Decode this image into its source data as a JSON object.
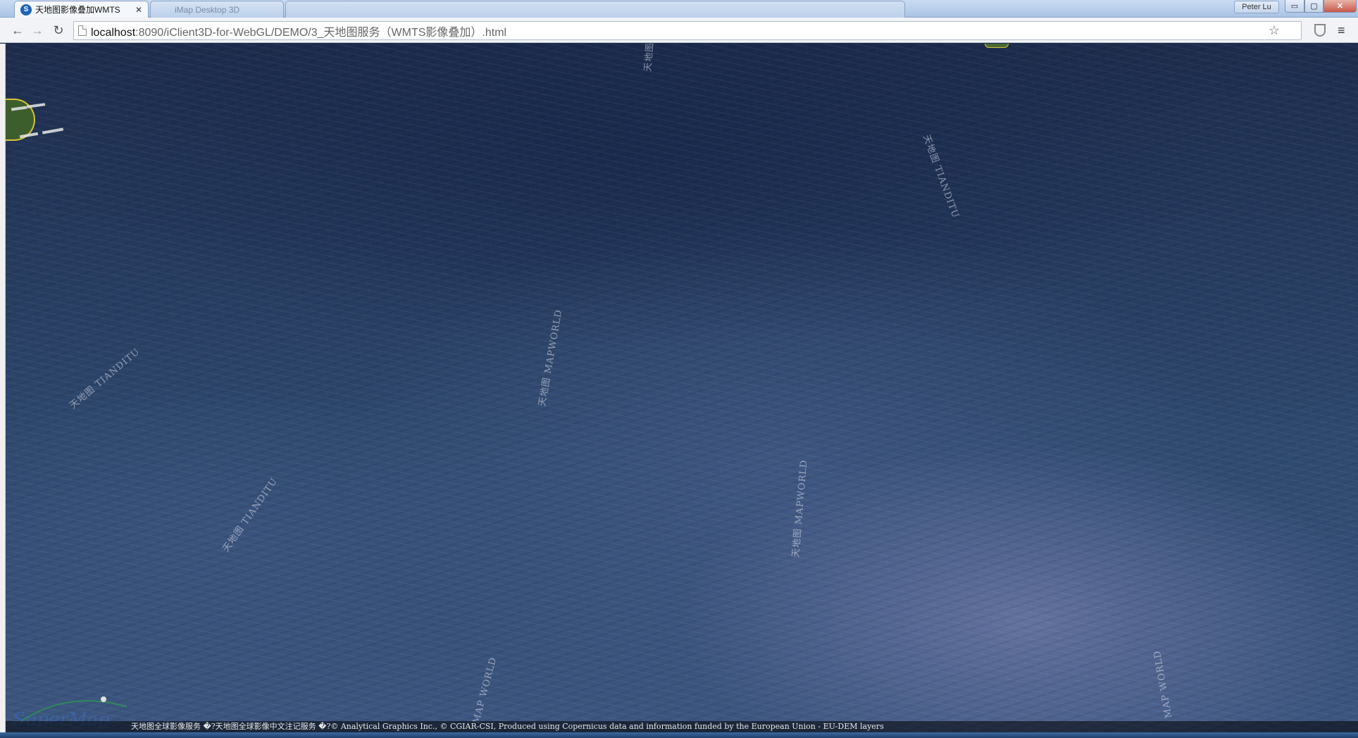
{
  "browser": {
    "tabs": [
      {
        "label": "天地图影像叠加WMTS",
        "favicon": "supermap-favicon",
        "active": true
      },
      {
        "label": "iMap Desktop 3D",
        "active": false
      }
    ],
    "profile_name": "Peter Lu",
    "window_buttons": {
      "minimize": "▭",
      "maximize": "▢",
      "close": "✕"
    },
    "nav": {
      "back": "←",
      "forward": "→",
      "reload": "↻",
      "menu": "≡",
      "bookmark": "☆"
    },
    "url": {
      "host": "localhost",
      "rest": ":8090/iClient3D-for-WebGL/DEMO/3_天地图服务（WMTS影像叠加）.html"
    }
  },
  "viewport": {
    "watermarks": [
      "天地图 TIANDITU",
      "天地图 MAPWORLD",
      "天地图 TIANDITU",
      "天地图 MAPWORLD",
      "天地图 TIANDITU",
      "天地图 MAPWORLD",
      "MAP WORLD",
      "MAP WORLD"
    ],
    "logo_text": "SuperMap",
    "credits": "天地图全球影像服务 �?天地图全球影像中文注记服务 �?© Analytical Graphics Inc., © CGIAR-CSI, Produced using Copernicus data and information funded by the European Union - EU-DEM layers"
  },
  "colors": {
    "ocean": "#2f4a70",
    "tab_active": "#f4f7fb",
    "close_button": "#c8584a"
  }
}
